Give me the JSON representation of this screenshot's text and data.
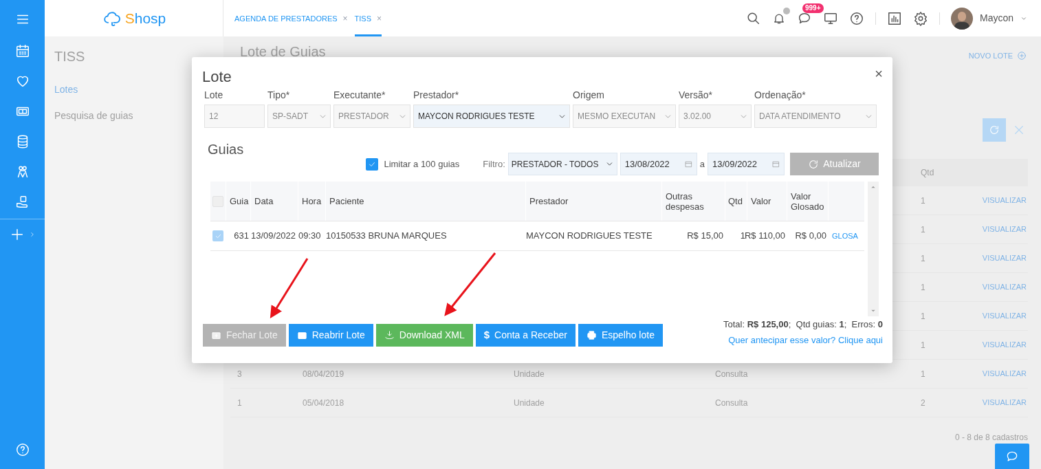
{
  "header": {
    "logo": {
      "accent": "S",
      "rest": "hosp"
    },
    "tabs": [
      {
        "label": "AGENDA DE PRESTADORES",
        "selected": false,
        "close": "×"
      },
      {
        "label": "TISS",
        "selected": true,
        "close": "×"
      }
    ],
    "chat_badge": "999+",
    "user": {
      "name": "Maycon"
    }
  },
  "left_panel": {
    "title": "TISS",
    "items": [
      {
        "label": "Lotes",
        "selected": true
      },
      {
        "label": "Pesquisa de guias",
        "selected": false
      }
    ]
  },
  "page": {
    "title": "Lote de Guias",
    "new_button": "NOVO LOTE",
    "table": {
      "qtd_header": "Qtd",
      "rows": [
        {
          "qtd": "1",
          "action": "VISUALIZAR"
        },
        {
          "qtd": "1",
          "action": "VISUALIZAR"
        },
        {
          "qtd": "1",
          "action": "VISUALIZAR"
        },
        {
          "qtd": "1",
          "action": "VISUALIZAR"
        },
        {
          "qtd": "1",
          "action": "VISUALIZAR"
        },
        {
          "qtd": "1",
          "action": "VISUALIZAR"
        },
        {
          "number": "3",
          "date": "08/04/2019",
          "unit": "Unidade",
          "type": "Consulta",
          "qtd": "1",
          "action": "VISUALIZAR"
        },
        {
          "number": "1",
          "date": "05/04/2018",
          "unit": "Unidade",
          "type": "Consulta",
          "qtd": "2",
          "action": "VISUALIZAR"
        }
      ]
    },
    "footer": "0 - 8 de 8 cadastros"
  },
  "modal": {
    "title": "Lote",
    "close": "×",
    "fields": [
      {
        "label": "Lote",
        "value": "12",
        "kind": "input",
        "disabled": true
      },
      {
        "label": "Tipo*",
        "value": "SP-SADT",
        "kind": "select",
        "disabled": true
      },
      {
        "label": "Executante*",
        "value": "PRESTADOR",
        "kind": "select",
        "disabled": true
      },
      {
        "label": "Prestador*",
        "value": "MAYCON RODRIGUES TESTE",
        "kind": "select",
        "disabled": false
      },
      {
        "label": "Origem",
        "value": "MESMO EXECUTAN",
        "kind": "select",
        "disabled": true
      },
      {
        "label": "Versão*",
        "value": "3.02.00",
        "kind": "select",
        "disabled": true
      },
      {
        "label": "Ordenação*",
        "value": "DATA ATENDIMENTO",
        "kind": "select",
        "disabled": true
      }
    ],
    "section_title": "Guias",
    "limit": {
      "label": "Limitar a 100 guias",
      "checked": true
    },
    "filter": {
      "label": "Filtro:",
      "value": "PRESTADOR - TODOS",
      "date_from": "13/08/2022",
      "separator": "a",
      "date_to": "13/09/2022",
      "refresh": "Atualizar",
      "refresh_disabled": true
    },
    "table": {
      "all_checked": false,
      "columns": [
        "Guia",
        "Data",
        "Hora",
        "Paciente",
        "Prestador",
        "Outras despesas",
        "Qtd",
        "Valor",
        "Valor Glosado"
      ],
      "rows": [
        {
          "checked": true,
          "cells": [
            "631",
            "13/09/2022",
            "09:30",
            "10150533 BRUNA MARQUES",
            "MAYCON RODRIGUES TESTE",
            "R$ 15,00",
            "1",
            "R$ 110,00",
            "R$ 0,00"
          ],
          "action": "GLOSA"
        }
      ]
    },
    "buttons": [
      {
        "label": "Fechar Lote",
        "kind": "box",
        "color": "#b3b3b3",
        "disabled": true
      },
      {
        "label": "Reabrir Lote",
        "kind": "box",
        "color": "#2196f3",
        "disabled": false
      },
      {
        "label": "Download XML",
        "kind": "download",
        "color": "#5cb85c",
        "disabled": false
      },
      {
        "label": "Conta a Receber",
        "kind": "glyph",
        "glyph": "$",
        "color": "#2196f3",
        "disabled": false
      },
      {
        "label": "Espelho lote",
        "kind": "print",
        "color": "#2196f3",
        "disabled": false
      }
    ],
    "summary": "Total: **R$ 125,00**;  Qtd guias: **1**;  Erros: **0**",
    "link": "Quer antecipar esse valor? Clique aqui"
  }
}
